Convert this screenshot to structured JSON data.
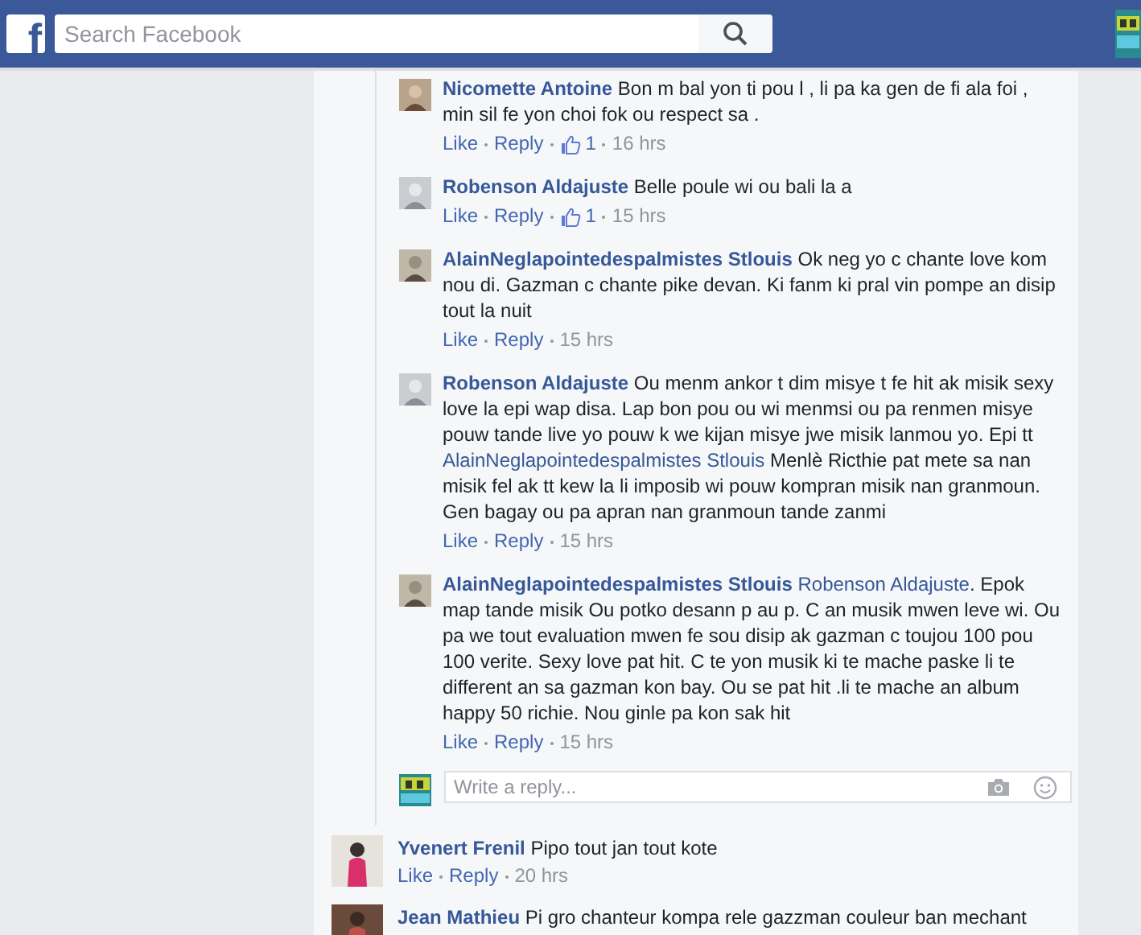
{
  "header": {
    "logo": "f",
    "search": {
      "placeholder": "Search Facebook"
    }
  },
  "replies": [
    {
      "author": "Nicomette Antoine",
      "parts": [
        {
          "kind": "text",
          "text": "Bon m bal yon ti pou l , li pa ka gen de fi ala foi , min sil fe yon choi fok ou respect sa ."
        }
      ],
      "actions": [
        "Like",
        "Reply"
      ],
      "likes": "1",
      "time": "16 hrs"
    },
    {
      "author": "Robenson Aldajuste",
      "parts": [
        {
          "kind": "text",
          "text": "Belle poule wi ou bali la a"
        }
      ],
      "actions": [
        "Like",
        "Reply"
      ],
      "likes": "1",
      "time": "15 hrs"
    },
    {
      "author": "AlainNeglapointedespalmistes Stlouis",
      "parts": [
        {
          "kind": "text",
          "text": "Ok neg yo c chante love kom nou di. Gazman c chante pike devan. Ki fanm ki pral vin pompe an disip tout la nuit"
        }
      ],
      "actions": [
        "Like",
        "Reply"
      ],
      "time": "15 hrs"
    },
    {
      "author": "Robenson Aldajuste",
      "parts": [
        {
          "kind": "text",
          "text": "Ou menm ankor t dim misye t fe hit ak misik sexy love la epi wap disa. Lap bon pou ou wi menmsi ou pa renmen misye pouw tande live yo pouw k we kijan misye jwe misik lanmou yo. Epi tt "
        },
        {
          "kind": "mention",
          "text": "AlainNeglapointedespalmistes Stlouis"
        },
        {
          "kind": "text",
          "text": " Menlè Ricthie pat mete sa nan misik fel ak tt kew la li imposib wi pouw kompran misik nan granmoun. Gen bagay ou pa apran nan granmoun tande zanmi"
        }
      ],
      "actions": [
        "Like",
        "Reply"
      ],
      "time": "15 hrs"
    },
    {
      "author": "AlainNeglapointedespalmistes Stlouis",
      "parts": [
        {
          "kind": "mention",
          "text": "Robenson Aldajuste"
        },
        {
          "kind": "text",
          "text": ". Epok map tande misik Ou potko desann p au p. C an musik mwen leve wi. Ou pa we tout evaluation mwen fe sou disip ak gazman c toujou 100 pou 100 verite. Sexy love pat hit. C te yon musik ki te mache paske li te different an sa gazman kon bay. Ou se pat hit .li te mache an album happy 50 richie. Nou ginle pa kon sak hit"
        }
      ],
      "actions": [
        "Like",
        "Reply"
      ],
      "time": "15 hrs"
    }
  ],
  "reply_box": {
    "placeholder": "Write a reply..."
  },
  "comments": [
    {
      "author": "Yvenert Frenil",
      "parts": [
        {
          "kind": "text",
          "text": "Pipo tout jan tout kote"
        }
      ],
      "actions": [
        "Like",
        "Reply"
      ],
      "time": "20 hrs"
    },
    {
      "author": "Jean Mathieu",
      "parts": [
        {
          "kind": "text",
          "text": "Pi gro chanteur kompa rele gazzman couleur ban mechant"
        }
      ]
    }
  ]
}
